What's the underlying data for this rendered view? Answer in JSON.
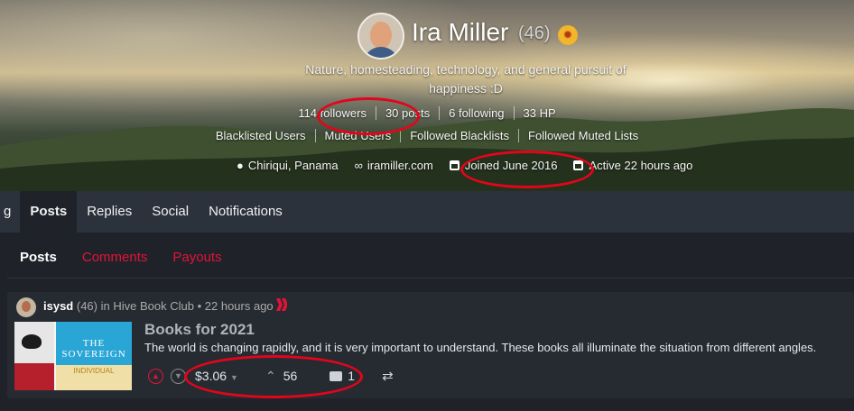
{
  "profile": {
    "name": "Ira Miller",
    "reputation": "(46)",
    "about": "Nature, homesteading, technology, and general pursuit of happiness :D",
    "stats": [
      "114 followers",
      "30 posts",
      "6 following",
      "33 HP"
    ],
    "lists": [
      "Blacklisted Users",
      "Muted Users",
      "Followed Blacklists",
      "Followed Muted Lists"
    ],
    "location": "Chiriqui, Panama",
    "website": "iramiller.com",
    "joined": "Joined June 2016",
    "active": "Active 22 hours ago"
  },
  "nav": {
    "edge": "g",
    "tabs": [
      "Posts",
      "Replies",
      "Social",
      "Notifications"
    ]
  },
  "subnav": [
    "Posts",
    "Comments",
    "Payouts"
  ],
  "post": {
    "author": "isysd",
    "author_rep": "(46)",
    "community_prefix": "in",
    "community": "Hive Book Club",
    "time": "• 22 hours ago",
    "title": "Books for 2021",
    "excerpt": "The world is changing rapidly, and it is very important to understand. These books all illuminate the situation from different angles.",
    "payout": "$3.06",
    "votes": "56",
    "comments": "1",
    "thumb_title": "THE SOVEREIGN",
    "thumb_sub": "INDIVIDUAL"
  },
  "colors": {
    "accent": "#e31337",
    "annotation": "#e3051b"
  }
}
